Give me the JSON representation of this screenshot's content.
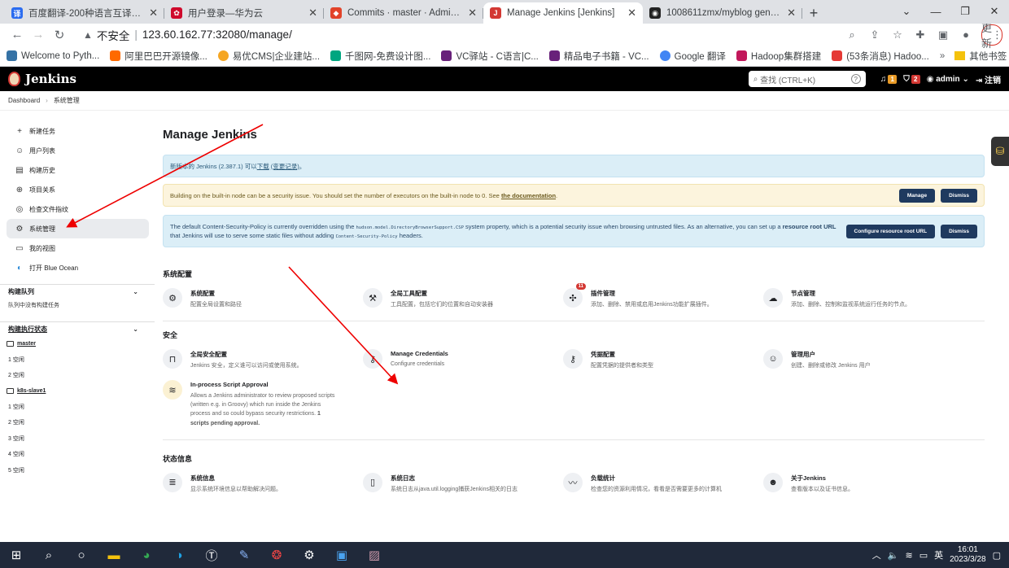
{
  "browser": {
    "tabs": [
      {
        "title": "百度翻译-200种语言互译、沟通",
        "color": "#2b6cf0",
        "glyph": "译"
      },
      {
        "title": "用户登录—华为云",
        "color": "#cf0a2c",
        "glyph": "✿"
      },
      {
        "title": "Commits · master · Administrat",
        "color": "#e24329",
        "glyph": "◆"
      },
      {
        "title": "Manage Jenkins [Jenkins]",
        "color": "#d33833",
        "glyph": "J"
      },
      {
        "title": "1008611zmx/myblog general",
        "color": "#222222",
        "glyph": "◉"
      }
    ],
    "address": {
      "security": "不安全",
      "url": "123.60.162.77:32080/manage/"
    },
    "update_label": "更新",
    "bookmarks": [
      {
        "label": "Welcome to Pyth...",
        "color": "#3572a5"
      },
      {
        "label": "阿里巴巴开源镜像...",
        "color": "#ff6a00"
      },
      {
        "label": "易优CMS|企业建站...",
        "color": "#f5a623"
      },
      {
        "label": "千图网-免费设计图...",
        "color": "#00a680"
      },
      {
        "label": "VC驿站 - C语言|C...",
        "color": "#68217a"
      },
      {
        "label": "精品电子书籍 - VC...",
        "color": "#68217a"
      },
      {
        "label": "Google 翻译",
        "color": "#4285f4"
      },
      {
        "label": "Hadoop集群搭建",
        "color": "#c2185b"
      },
      {
        "label": "(53条消息) Hadoo...",
        "color": "#e53935"
      }
    ],
    "other_bookmarks": "其他书签"
  },
  "jenkins": {
    "logo": "Jenkins",
    "search_placeholder": "查找 (CTRL+K)",
    "notif_count": "1",
    "security_count": "2",
    "user": "admin",
    "logout": "注销",
    "breadcrumb": [
      "Dashboard",
      "系统管理"
    ]
  },
  "sidebar": {
    "items": [
      {
        "label": "新建任务",
        "icon": "plus-icon",
        "glyph": "+"
      },
      {
        "label": "用户列表",
        "icon": "people-icon",
        "glyph": "☺"
      },
      {
        "label": "构建历史",
        "icon": "history-icon",
        "glyph": "▤"
      },
      {
        "label": "项目关系",
        "icon": "relation-icon",
        "glyph": "⊕"
      },
      {
        "label": "检查文件指纹",
        "icon": "fingerprint-icon",
        "glyph": "◎"
      },
      {
        "label": "系统管理",
        "icon": "gear-icon",
        "glyph": "⚙"
      },
      {
        "label": "我的视图",
        "icon": "view-icon",
        "glyph": "▭"
      },
      {
        "label": "打开 Blue Ocean",
        "icon": "blue-ocean-icon",
        "glyph": "◐"
      }
    ],
    "queue_title": "构建队列",
    "queue_empty": "队列中没有构建任务",
    "executors_title": "构建执行状态",
    "nodes": [
      {
        "name": "master",
        "executors": [
          "1 空闲",
          "2 空闲"
        ]
      },
      {
        "name": "k8s-slave1",
        "executors": [
          "1 空闲",
          "2 空闲",
          "3 空闲",
          "4 空闲",
          "5 空闲"
        ]
      }
    ]
  },
  "main": {
    "title": "Manage Jenkins",
    "alert_update": {
      "text": "新版本的 Jenkins (2.387.1) 可以",
      "download": "下载",
      "changelog": "(变更记录)",
      "end": "。"
    },
    "alert_security": {
      "text": "Building on the built-in node can be a security issue. You should set the number of executors on the built-in node to 0. See ",
      "link": "the documentation",
      "end": ".",
      "manage": "Manage",
      "dismiss": "Dismiss"
    },
    "alert_csp": {
      "text1": "The default Content-Security-Policy is currently overridden using the ",
      "code1": "hudson.model.DirectoryBrowserSupport.CSP",
      "text2": " system property, which is a potential security issue when browsing untrusted files. As an alternative, you can set up a ",
      "link": "resource root URL",
      "text3": " that Jenkins will use to serve some static files without adding ",
      "code2": "Content-Security-Policy",
      "text4": " headers.",
      "configure": "Configure resource root URL",
      "dismiss": "Dismiss"
    },
    "sections": [
      {
        "title": "系统配置",
        "cards": [
          {
            "name": "系统配置",
            "desc": "配置全局设置和路径",
            "icon": "gear-icon",
            "glyph": "⚙"
          },
          {
            "name": "全局工具配置",
            "desc": "工具配置，包括它们的位置和自动安装器",
            "icon": "hammer-icon",
            "glyph": "⚒"
          },
          {
            "name": "插件管理",
            "desc": "添加、删除、禁用或启用Jenkins功能扩展插件。",
            "icon": "puzzle-icon",
            "glyph": "✣",
            "badge": "11"
          },
          {
            "name": "节点管理",
            "desc": "添加、删除、控制和监视系统运行任务的节点。",
            "icon": "cloud-icon",
            "glyph": "☁"
          }
        ]
      },
      {
        "title": "安全",
        "cards": [
          {
            "name": "全局安全配置",
            "desc": "Jenkins 安全，定义谁可以访问或使用系统。",
            "icon": "lock-icon",
            "glyph": "🔒"
          },
          {
            "name": "Manage Credentials",
            "desc": "Configure credentials",
            "icon": "key-icon",
            "glyph": "⚷"
          },
          {
            "name": "凭据配置",
            "desc": "配置凭据的提供者和类型",
            "icon": "key-icon",
            "glyph": "⚷"
          },
          {
            "name": "管理用户",
            "desc": "创建、删除或修改 Jenkins 用户",
            "icon": "users-icon",
            "glyph": "☺"
          },
          {
            "name": "In-process Script Approval",
            "desc": "Allows a Jenkins administrator to review proposed scripts (written e.g. in Groovy) which run inside the Jenkins process and so could bypass security restrictions.",
            "pending": "1 scripts pending approval.",
            "icon": "script-icon",
            "glyph": "≋"
          }
        ]
      },
      {
        "title": "状态信息",
        "cards": [
          {
            "name": "系统信息",
            "desc": "显示系统环境信息以帮助解决问题。",
            "icon": "database-icon",
            "glyph": "≣"
          },
          {
            "name": "系统日志",
            "desc": "系统日志从java.util.logging捕获Jenkins相关的日志",
            "icon": "log-icon",
            "glyph": "▯"
          },
          {
            "name": "负载统计",
            "desc": "检查您的资源利用情况，看看是否需要更多的计算机",
            "icon": "chart-icon",
            "glyph": "〰"
          },
          {
            "name": "关于Jenkins",
            "desc": "查看版本以及证书信息。",
            "icon": "jenkins-icon",
            "glyph": "☻"
          }
        ]
      }
    ]
  },
  "taskbar": {
    "ime": "英",
    "time": "16:01",
    "date": "2023/3/28"
  }
}
